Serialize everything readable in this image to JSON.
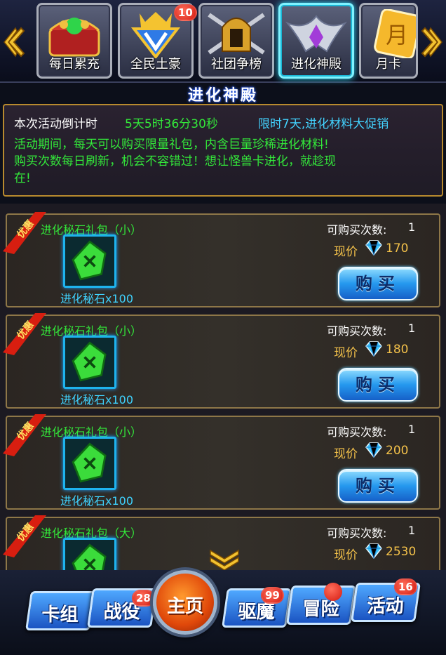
{
  "tabs": [
    {
      "label": "每日累充",
      "icon": "treasure-chest-icon",
      "active": false
    },
    {
      "label": "全民土豪",
      "icon": "crown-shield-icon",
      "active": false,
      "badge": "10"
    },
    {
      "label": "社团争榜",
      "icon": "helmet-swords-icon",
      "active": false
    },
    {
      "label": "进化神殿",
      "icon": "winged-crest-icon",
      "active": true
    },
    {
      "label": "月卡",
      "icon": "month-card-icon",
      "active": false
    }
  ],
  "section_title": "进化神殿",
  "info": {
    "countdown_label": "本次活动倒计时",
    "countdown_value": "5天5时36分30秒",
    "promo": "限时7天,进化材料大促销",
    "desc_line1": "活动期间，每天可以购买限量礼包，内含巨量珍稀进化材料!",
    "desc_line2": "购买次数每日刷新，机会不容错过！想让怪兽卡进化，就趁现",
    "desc_line3": "在!"
  },
  "packages": [
    {
      "ribbon": "优惠",
      "name": "进化秘石礼包（小）",
      "item": "进化秘石x100",
      "qty_label": "可购买次数:",
      "qty": "1",
      "price_label": "现价",
      "price": "170",
      "buy": "购买"
    },
    {
      "ribbon": "优惠",
      "name": "进化秘石礼包（小）",
      "item": "进化秘石x100",
      "qty_label": "可购买次数:",
      "qty": "1",
      "price_label": "现价",
      "price": "180",
      "buy": "购买"
    },
    {
      "ribbon": "优惠",
      "name": "进化秘石礼包（小）",
      "item": "进化秘石x100",
      "qty_label": "可购买次数:",
      "qty": "1",
      "price_label": "现价",
      "price": "200",
      "buy": "购买"
    },
    {
      "ribbon": "优惠",
      "name": "进化秘石礼包（大）",
      "item": "",
      "qty_label": "可购买次数:",
      "qty": "1",
      "price_label": "现价",
      "price": "2530",
      "buy": ""
    }
  ],
  "nav": {
    "deck": "卡组",
    "campaign": "战役",
    "campaign_badge": "28",
    "home": "主页",
    "exorcise": "驱魔",
    "exorcise_badge": "99",
    "adventure": "冒险",
    "event": "活动",
    "event_badge": "16"
  },
  "colors": {
    "green_text": "#33e83a",
    "cyan_text": "#43d3ff",
    "gold_border": "#b88a2e",
    "buy_button": "#2598ee"
  }
}
